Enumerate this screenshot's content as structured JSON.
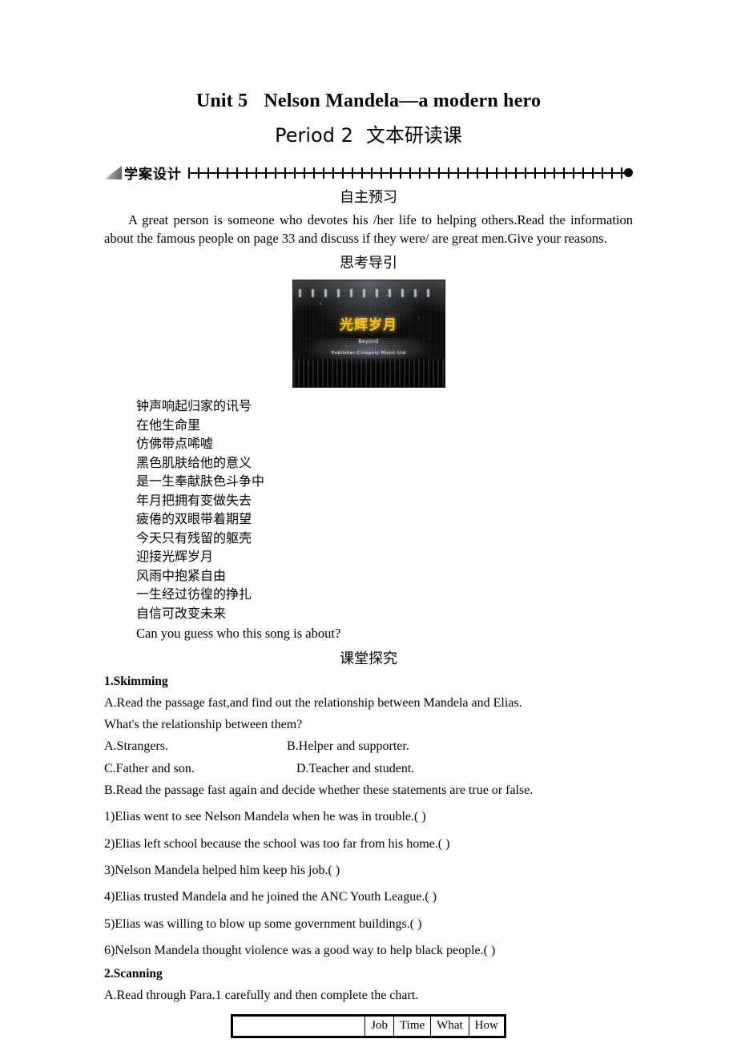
{
  "document": {
    "unit_title_left": "Unit 5",
    "unit_title_right": "Nelson Mandela—a modern hero",
    "period_title_left": "Period 2",
    "period_title_right": "文本研读课"
  },
  "band": {
    "label": "学案设计"
  },
  "preview": {
    "heading": "自主预习",
    "paragraph": "A great person is someone who devotes his /her life to helping others.Read the information about the famous people on page 33 and discuss if they were/ are great men.Give your reasons."
  },
  "thinking": {
    "heading": "思考导引",
    "photo": {
      "title_cjk": "光辉岁月",
      "caption_line": "Beyond",
      "caption_sub": "Publisher:Cinepoly Music Ltd"
    },
    "lyrics": [
      "钟声响起归家的讯号",
      "在他生命里",
      "仿佛带点唏嘘",
      "黑色肌肤给他的意义",
      "是一生奉献肤色斗争中",
      "年月把拥有变做失去",
      "疲倦的双眼带着期望",
      "今天只有残留的躯壳",
      "迎接光辉岁月",
      "风雨中抱紧自由",
      "一生经过彷徨的挣扎",
      "自信可改变未来"
    ],
    "question": "Can you guess who this song is about?"
  },
  "explore": {
    "heading": "课堂探究",
    "skimming": {
      "title": "1.Skimming",
      "line_a": "A.Read the passage fast,and find out the relationship between Mandela and Elias.",
      "question": "What's the relationship between them?",
      "options": [
        "A.Strangers.",
        "B.Helper and supporter.",
        "C.Father and son.",
        "D.Teacher and student."
      ],
      "line_b": "B.Read the passage fast again and decide whether these statements are true or false.",
      "statements": [
        "1)Elias went to see Nelson Mandela when he was in trouble.(        )",
        "2)Elias left school because the school was too far from his home.(        )",
        "3)Nelson Mandela helped him keep his job.(        )",
        "4)Elias trusted Mandela and he joined the ANC Youth League.(        )",
        "5)Elias was willing to blow up some government buildings.(        )",
        "6)Nelson Mandela thought violence was a good way to help black people.(        )"
      ]
    },
    "scanning": {
      "title": "2.Scanning",
      "line_a": "A.Read through Para.1 carefully and then complete the chart.",
      "chart_headers": [
        "",
        "Job",
        "Time",
        "What",
        "How"
      ]
    }
  }
}
